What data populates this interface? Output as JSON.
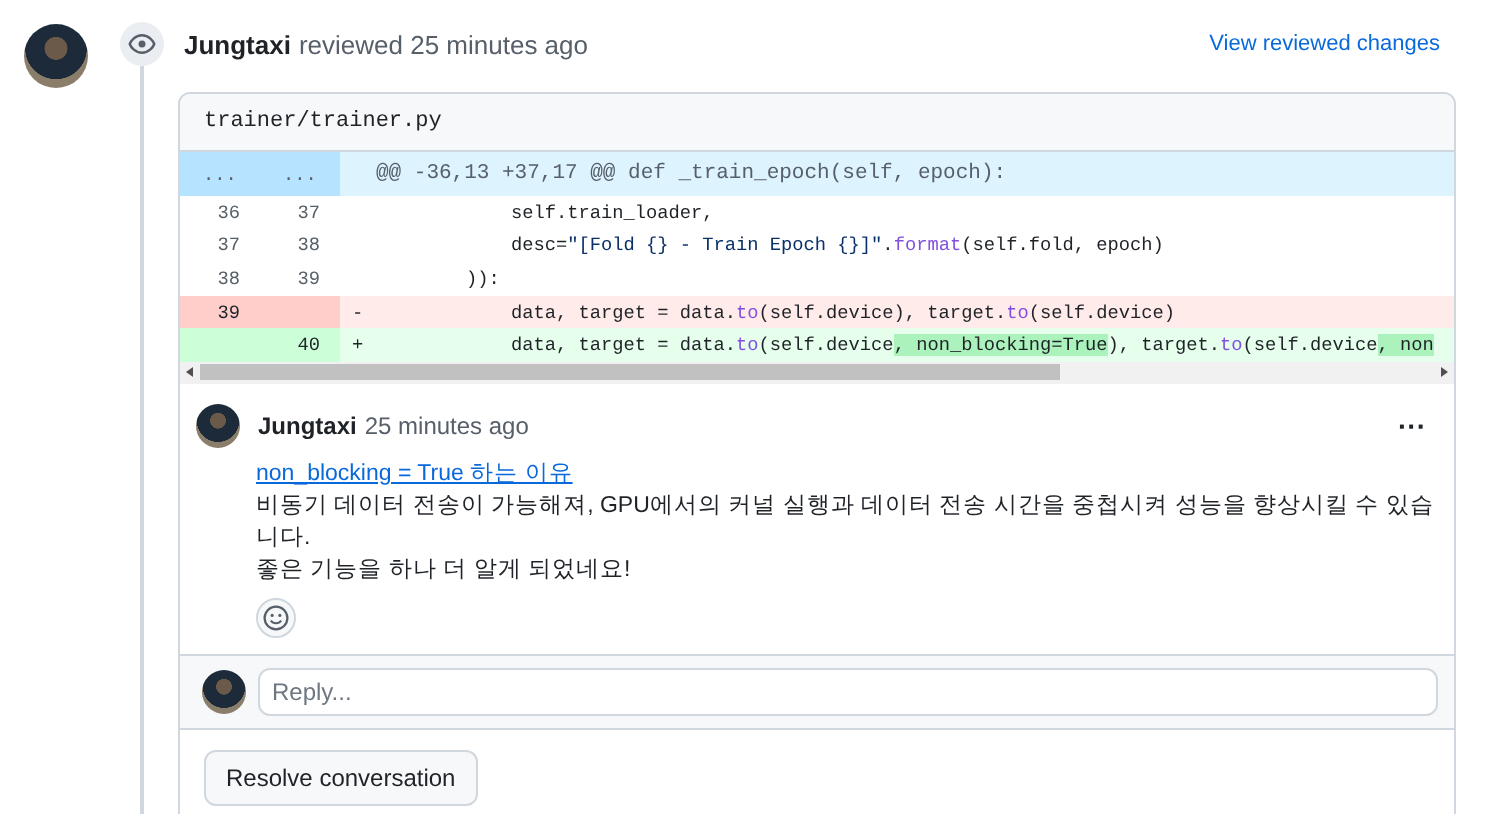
{
  "review": {
    "author": "Jungtaxi",
    "action": "reviewed 25 minutes ago",
    "link": "View reviewed changes"
  },
  "file": {
    "path": "trainer/trainer.py"
  },
  "diff": [
    {
      "kind": "hunk",
      "old": "...",
      "new": "...",
      "code": [
        {
          "t": "@@ -36,13 +37,17 @@ def _train_epoch(self, epoch):",
          "kind": "plain"
        }
      ]
    },
    {
      "kind": "context",
      "old": "36",
      "new": "37",
      "code": [
        {
          "t": "            self.train_loader,",
          "kind": "plain"
        }
      ]
    },
    {
      "kind": "context",
      "old": "37",
      "new": "38",
      "code": [
        {
          "t": "            desc=",
          "kind": "plain"
        },
        {
          "t": "\"[Fold {} - Train Epoch {}]\"",
          "kind": "string"
        },
        {
          "t": ".",
          "kind": "plain"
        },
        {
          "t": "format",
          "kind": "func"
        },
        {
          "t": "(self.fold, epoch)",
          "kind": "plain"
        }
      ]
    },
    {
      "kind": "context",
      "old": "38",
      "new": "39",
      "code": [
        {
          "t": "        )):",
          "kind": "plain"
        }
      ]
    },
    {
      "kind": "del",
      "old": "39",
      "sign": "-",
      "code": [
        {
          "t": "            data, target = data.",
          "kind": "plain"
        },
        {
          "t": "to",
          "kind": "func"
        },
        {
          "t": "(self.device), target.",
          "kind": "plain"
        },
        {
          "t": "to",
          "kind": "func"
        },
        {
          "t": "(self.device)",
          "kind": "plain"
        }
      ]
    },
    {
      "kind": "add",
      "new": "40",
      "sign": "+",
      "code": [
        {
          "t": "            data, target = data.",
          "kind": "plain"
        },
        {
          "t": "to",
          "kind": "func"
        },
        {
          "t": "(self.device",
          "kind": "plain"
        },
        {
          "t": ", non_blocking=True",
          "kind": "hl"
        },
        {
          "t": "), target.",
          "kind": "plain"
        },
        {
          "t": "to",
          "kind": "func"
        },
        {
          "t": "(self.device",
          "kind": "plain"
        },
        {
          "t": ", non",
          "kind": "hl"
        }
      ]
    }
  ],
  "comment": {
    "author": "Jungtaxi",
    "time": "25 minutes ago",
    "menu": "···",
    "link": "non_blocking = True 하는 이유",
    "lines": [
      "비동기 데이터 전송이 가능해져, GPU에서의 커널 실행과 데이터 전송 시간을 중첩시켜 성능을 향상시킬 수 있습니다.",
      "좋은 기능을 하나 더 알게 되었네요!"
    ]
  },
  "reply": {
    "placeholder": "Reply..."
  },
  "resolve_button": "Resolve conversation"
}
